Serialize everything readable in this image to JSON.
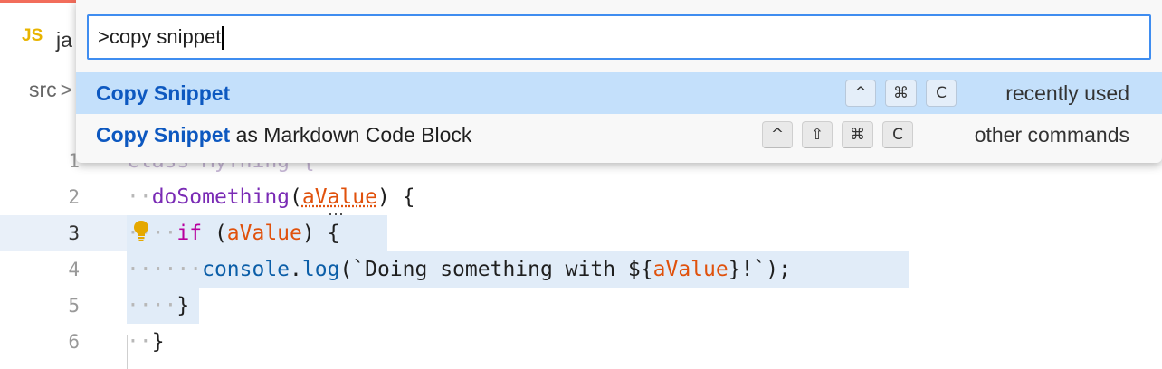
{
  "tab": {
    "icon": "JS",
    "label": "ja"
  },
  "breadcrumb": {
    "root": "src",
    "separator": ">"
  },
  "palette": {
    "query": ">copy snippet",
    "results": [
      {
        "highlight": "Copy Snippet",
        "rest": "",
        "keys": [
          "^",
          "⌘",
          "C"
        ],
        "group": "recently used",
        "selected": true
      },
      {
        "highlight": "Copy Snippet",
        "rest": " as Markdown Code Block",
        "keys": [
          "^",
          "⇧",
          "⌘",
          "C"
        ],
        "group": "other commands",
        "selected": false
      }
    ]
  },
  "editor": {
    "active_line": 3,
    "line_numbers": [
      "1",
      "2",
      "3",
      "4",
      "5",
      "6"
    ],
    "lines": {
      "l1": {
        "kw": "class",
        "name": " MyThing {"
      },
      "l2": {
        "ws": "··",
        "fn": "doSomething",
        "open": "(",
        "param": "aValue",
        "close": ") {"
      },
      "l3": {
        "ws": "····",
        "kw": "if",
        "open": " (",
        "param": "aValue",
        "close": ") {"
      },
      "l4": {
        "ws": "······",
        "obj": "console",
        "dot": ".",
        "fn": "log",
        "str1": "(`Doing something with ${",
        "param": "aValue",
        "str2": "}!`);"
      },
      "l5": {
        "ws": "····",
        "close": "}"
      },
      "l6": {
        "ws": "··",
        "close": "}"
      }
    },
    "hover_dots": "…"
  },
  "colors": {
    "accent": "#3f8df0",
    "selected_row": "#c4e0fb",
    "match_highlight": "#0d58c0",
    "variable": "#e0510c",
    "function": "#7a2bb5",
    "keyword": "#b8009e",
    "lightbulb": "#e5a800"
  }
}
